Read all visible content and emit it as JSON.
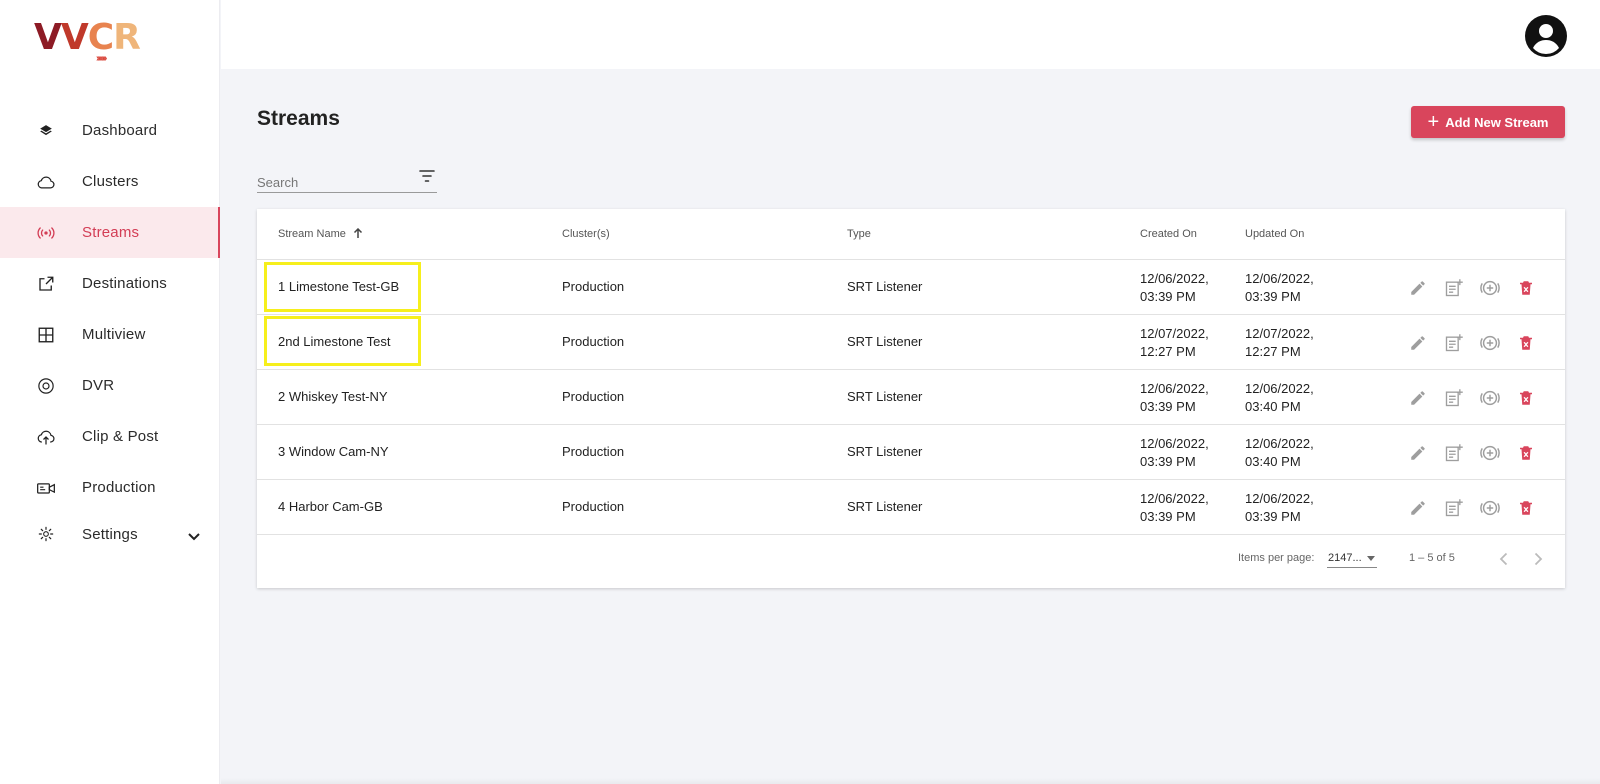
{
  "brand": {
    "logo_letters": [
      "V",
      "V",
      "C",
      "R"
    ],
    "logo_arrows": "›››››››"
  },
  "sidebar": {
    "items": [
      {
        "label": "Dashboard",
        "icon": "layers-icon"
      },
      {
        "label": "Clusters",
        "icon": "cloud-icon"
      },
      {
        "label": "Streams",
        "icon": "broadcast-icon",
        "active": true
      },
      {
        "label": "Destinations",
        "icon": "external-link-icon"
      },
      {
        "label": "Multiview",
        "icon": "grid-icon"
      },
      {
        "label": "DVR",
        "icon": "record-icon"
      },
      {
        "label": "Clip & Post",
        "icon": "cloud-upload-icon"
      },
      {
        "label": "Production",
        "icon": "video-camera-icon"
      },
      {
        "label": "Settings",
        "icon": "gear-icon",
        "expandable": true
      }
    ]
  },
  "header": {
    "avatar_icon": "account-circle-icon"
  },
  "page": {
    "title": "Streams",
    "add_button": "Add New Stream",
    "search_placeholder": "Search"
  },
  "table": {
    "columns": [
      "Stream Name",
      "Cluster(s)",
      "Type",
      "Created On",
      "Updated On"
    ],
    "sort_column": "Stream Name",
    "sort_direction": "ascending",
    "rows": [
      {
        "name": "1 Limestone Test-GB",
        "cluster": "Production",
        "type": "SRT Listener",
        "created_date": "12/06/2022,",
        "created_time": "03:39 PM",
        "updated_date": "12/06/2022,",
        "updated_time": "03:39 PM",
        "highlighted": true
      },
      {
        "name": "2nd Limestone Test",
        "cluster": "Production",
        "type": "SRT Listener",
        "created_date": "12/07/2022,",
        "created_time": "12:27 PM",
        "updated_date": "12/07/2022,",
        "updated_time": "12:27 PM",
        "highlighted": true
      },
      {
        "name": "2 Whiskey Test-NY",
        "cluster": "Production",
        "type": "SRT Listener",
        "created_date": "12/06/2022,",
        "created_time": "03:39 PM",
        "updated_date": "12/06/2022,",
        "updated_time": "03:40 PM",
        "highlighted": false
      },
      {
        "name": "3 Window Cam-NY",
        "cluster": "Production",
        "type": "SRT Listener",
        "created_date": "12/06/2022,",
        "created_time": "03:39 PM",
        "updated_date": "12/06/2022,",
        "updated_time": "03:40 PM",
        "highlighted": false
      },
      {
        "name": "4 Harbor Cam-GB",
        "cluster": "Production",
        "type": "SRT Listener",
        "created_date": "12/06/2022,",
        "created_time": "03:39 PM",
        "updated_date": "12/06/2022,",
        "updated_time": "03:39 PM",
        "highlighted": false
      }
    ],
    "row_actions": [
      "edit-icon",
      "add-note-icon",
      "add-circle-icon",
      "delete-icon"
    ]
  },
  "pagination": {
    "items_per_page_label": "Items per page:",
    "items_per_page_value": "2147...",
    "range": "1 – 5 of 5"
  },
  "colors": {
    "accent": "#d9455c",
    "highlight": "#f6ef1c",
    "active_bg": "#fbe9ec",
    "delete": "#d9455c",
    "icon_gray": "#9e9e9e"
  }
}
